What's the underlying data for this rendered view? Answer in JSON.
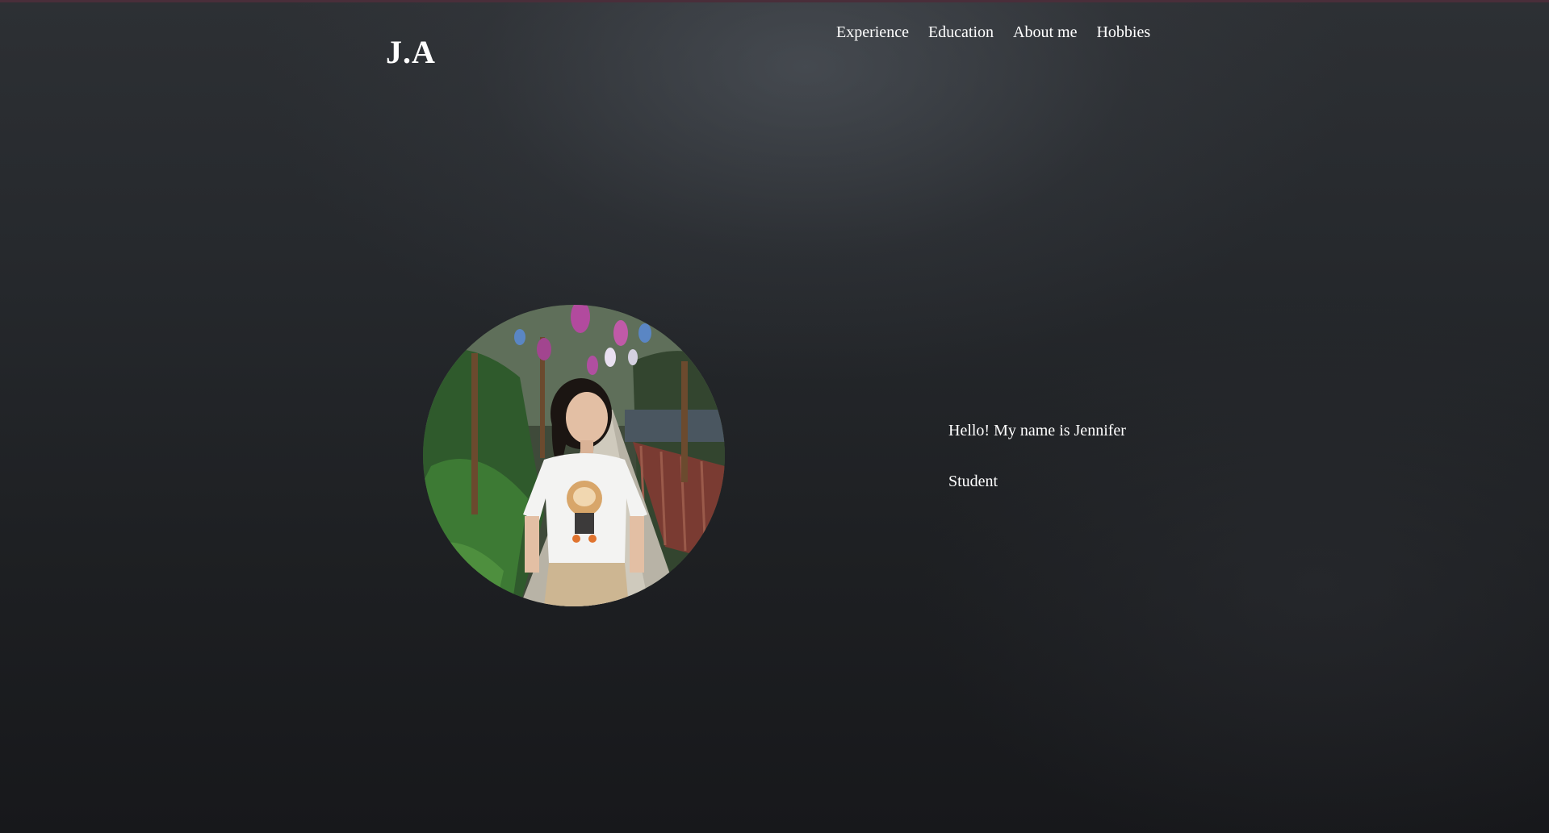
{
  "header": {
    "logo": "J.A",
    "nav": [
      {
        "label": "Experience"
      },
      {
        "label": "Education"
      },
      {
        "label": "About me"
      },
      {
        "label": "Hobbies"
      }
    ]
  },
  "hero": {
    "greeting": "Hello! My name is Jennifer",
    "role": "Student",
    "photo": {
      "icon": "profile-photo"
    }
  },
  "colors": {
    "background": "#1e2023",
    "text": "#ffffff",
    "accent_line": "#4a2e3a"
  }
}
